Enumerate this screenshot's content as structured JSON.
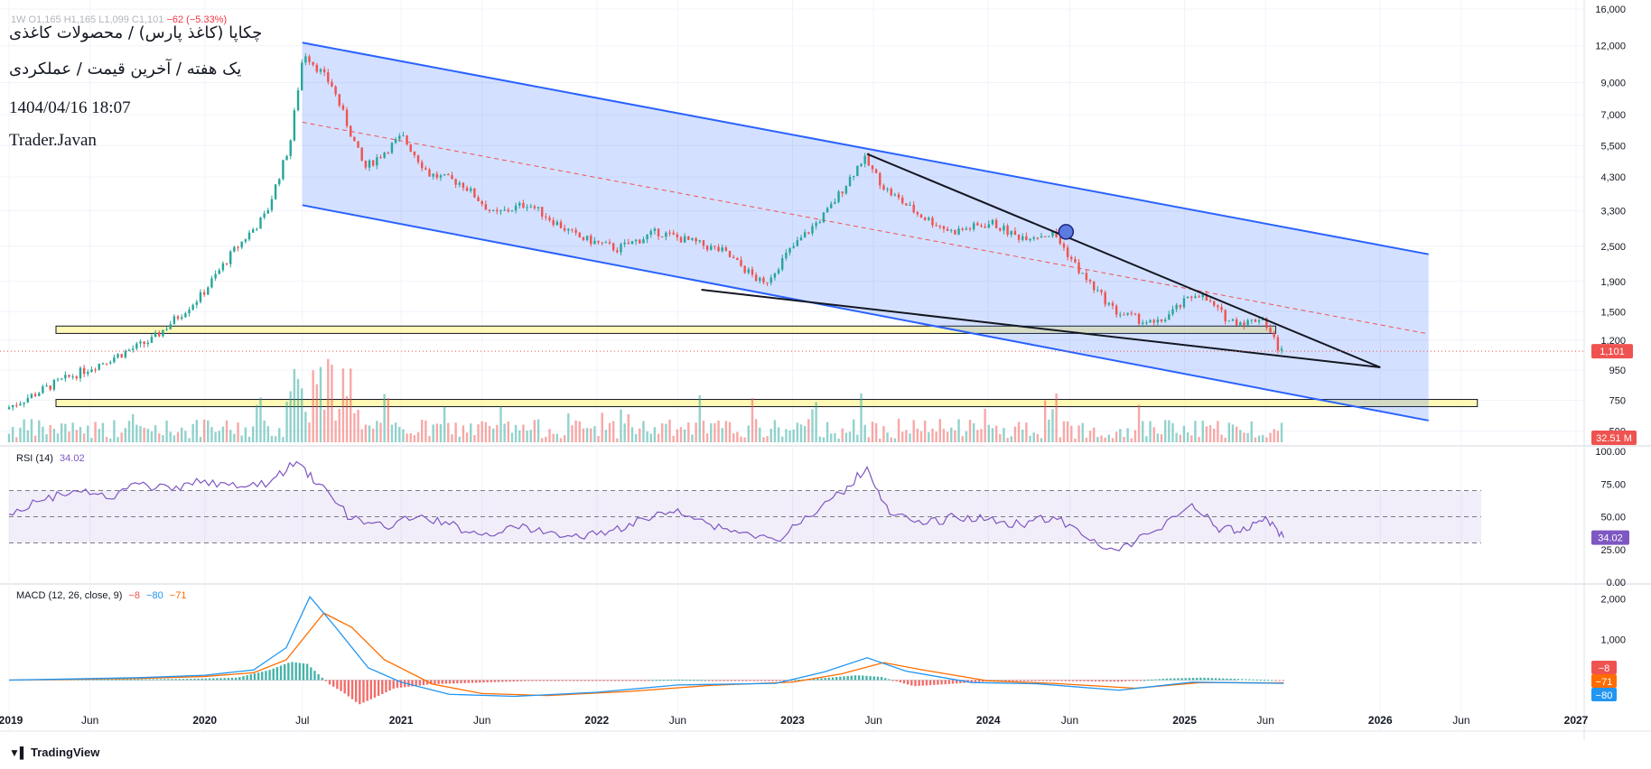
{
  "header": {
    "ohlc_prefix": "1W  O1,165  H1,165  L1,099  C1,101",
    "change": "−62 (−5.33%)",
    "title_line1": "چکاپا (کاغذ پارس) / محصولات کاغذی",
    "title_line2": "یک هفته / آخرین قیمت / عملکردی",
    "timestamp": "1404/04/16 18:07",
    "author": "Trader.Javan"
  },
  "indicators": {
    "rsi_label": "RSI (14)",
    "rsi_value": "34.02",
    "macd_label": "MACD (12, 26, close, 9)",
    "macd_hist": "−8",
    "macd_line": "−80",
    "macd_signal": "−71"
  },
  "branding": {
    "logo_text": "TradingView"
  },
  "colors": {
    "up": "#26a69a",
    "down": "#ef5350",
    "channel": "#2962ff",
    "zone": "#fff59d",
    "rsi": "#7e57c2",
    "macd": "#2196f3",
    "signal": "#ff6d00"
  },
  "chart_data": [
    {
      "type": "candlestick",
      "scale": "log",
      "ylim": [
        540,
        16000
      ],
      "y_ticks": [
        16000,
        12000,
        9000,
        7000,
        5500,
        4300,
        3300,
        2500,
        1900,
        1500,
        1200,
        950,
        750,
        590
      ],
      "y_tick_labels": [
        "16,000",
        "12,000",
        "9,000",
        "7,000",
        "5,500",
        "4,300",
        "3,300",
        "2,500",
        "1,900",
        "1,500",
        "1,200",
        "950",
        "750",
        "590"
      ],
      "last_price": 1101,
      "last_price_label": "1,101",
      "volume_label": "32.51 M",
      "x_tick_labels": [
        "2019",
        "Jun",
        "2020",
        "Jul",
        "2021",
        "Jun",
        "2022",
        "Jun",
        "2023",
        "Jun",
        "2024",
        "Jun",
        "2025",
        "Jun",
        "2026",
        "Jun",
        "2027"
      ],
      "x_tick_dates": [
        "2019-01-01",
        "2019-06-01",
        "2020-01-01",
        "2020-07-01",
        "2021-01-01",
        "2021-06-01",
        "2022-01-01",
        "2022-06-01",
        "2023-01-01",
        "2023-06-01",
        "2024-01-01",
        "2024-06-01",
        "2025-01-01",
        "2025-06-01",
        "2026-01-01",
        "2026-06-01",
        "2027-01-01"
      ],
      "price_path": [
        [
          "2019-01-01",
          700
        ],
        [
          "2019-04-01",
          850
        ],
        [
          "2019-07-01",
          1010
        ],
        [
          "2019-10-01",
          1200
        ],
        [
          "2020-01-01",
          1700
        ],
        [
          "2020-03-01",
          2400
        ],
        [
          "2020-05-01",
          3200
        ],
        [
          "2020-06-15",
          5600
        ],
        [
          "2020-07-10",
          11500
        ],
        [
          "2020-09-01",
          8800
        ],
        [
          "2020-11-01",
          4600
        ],
        [
          "2021-01-10",
          5900
        ],
        [
          "2021-03-01",
          4400
        ],
        [
          "2021-05-01",
          4100
        ],
        [
          "2021-07-01",
          3200
        ],
        [
          "2021-09-01",
          3500
        ],
        [
          "2021-12-01",
          2700
        ],
        [
          "2022-02-15",
          2450
        ],
        [
          "2022-05-01",
          2800
        ],
        [
          "2022-07-01",
          2600
        ],
        [
          "2022-09-01",
          2400
        ],
        [
          "2022-11-15",
          1850
        ],
        [
          "2023-01-01",
          2400
        ],
        [
          "2023-03-15",
          3300
        ],
        [
          "2023-05-20",
          5000
        ],
        [
          "2023-07-01",
          3900
        ],
        [
          "2023-09-01",
          3200
        ],
        [
          "2023-11-01",
          2800
        ],
        [
          "2024-01-15",
          3000
        ],
        [
          "2024-03-01",
          2700
        ],
        [
          "2024-05-10",
          2750
        ],
        [
          "2024-07-01",
          2000
        ],
        [
          "2024-09-01",
          1500
        ],
        [
          "2024-11-15",
          1350
        ],
        [
          "2025-02-01",
          1750
        ],
        [
          "2025-04-01",
          1400
        ],
        [
          "2025-05-10",
          1380
        ],
        [
          "2025-06-01",
          1450
        ],
        [
          "2025-07-05",
          1101
        ]
      ],
      "channel_upper": [
        [
          "2020-07-01",
          12300
        ],
        [
          "2026-04-01",
          2350
        ]
      ],
      "channel_lower": [
        [
          "2020-07-01",
          3450
        ],
        [
          "2026-04-01",
          640
        ]
      ],
      "channel_mid": [
        [
          "2020-07-01",
          6600
        ],
        [
          "2026-04-01",
          1260
        ]
      ],
      "wedge_upper": [
        [
          "2023-05-20",
          5150
        ],
        [
          "2026-01-01",
          970
        ]
      ],
      "wedge_lower": [
        [
          "2022-07-15",
          1780
        ],
        [
          "2026-01-01",
          970
        ]
      ],
      "support_zones": [
        {
          "date_from": "2019-01-01",
          "date_to": "2025-06-20",
          "price_low": 1265,
          "price_high": 1340
        },
        {
          "date_from": "2019-01-01",
          "date_to": "2026-07-01",
          "price_low": 715,
          "price_high": 755
        }
      ],
      "marker": {
        "date": "2024-05-25",
        "price": 2800
      }
    },
    {
      "type": "line",
      "name": "RSI (14)",
      "ylim": [
        0,
        100
      ],
      "y_ticks": [
        100,
        75,
        50,
        25,
        0
      ],
      "y_tick_labels": [
        "100.00",
        "75.00",
        "50.00",
        "25.00",
        "0.00"
      ],
      "bands": [
        30,
        50,
        70
      ],
      "current_value_label": "34.02",
      "points": [
        [
          "2019-01-01",
          52
        ],
        [
          "2019-03-01",
          62
        ],
        [
          "2019-05-01",
          70
        ],
        [
          "2019-07-01",
          64
        ],
        [
          "2019-09-01",
          75
        ],
        [
          "2019-11-01",
          70
        ],
        [
          "2020-01-01",
          78
        ],
        [
          "2020-03-01",
          72
        ],
        [
          "2020-05-01",
          76
        ],
        [
          "2020-06-20",
          92
        ],
        [
          "2020-08-01",
          75
        ],
        [
          "2020-10-01",
          48
        ],
        [
          "2020-12-01",
          42
        ],
        [
          "2021-02-01",
          50
        ],
        [
          "2021-04-01",
          44
        ],
        [
          "2021-06-01",
          36
        ],
        [
          "2021-08-01",
          42
        ],
        [
          "2021-10-01",
          38
        ],
        [
          "2021-12-01",
          34
        ],
        [
          "2022-02-01",
          40
        ],
        [
          "2022-04-01",
          48
        ],
        [
          "2022-06-01",
          56
        ],
        [
          "2022-08-01",
          44
        ],
        [
          "2022-10-01",
          38
        ],
        [
          "2022-12-01",
          32
        ],
        [
          "2023-02-01",
          50
        ],
        [
          "2023-04-01",
          68
        ],
        [
          "2023-05-20",
          88
        ],
        [
          "2023-07-01",
          52
        ],
        [
          "2023-09-01",
          44
        ],
        [
          "2023-11-01",
          50
        ],
        [
          "2024-01-01",
          48
        ],
        [
          "2024-03-01",
          44
        ],
        [
          "2024-05-01",
          50
        ],
        [
          "2024-07-01",
          34
        ],
        [
          "2024-09-01",
          24
        ],
        [
          "2024-11-01",
          38
        ],
        [
          "2025-01-15",
          60
        ],
        [
          "2025-03-01",
          42
        ],
        [
          "2025-04-15",
          38
        ],
        [
          "2025-06-01",
          50
        ],
        [
          "2025-07-05",
          34
        ]
      ]
    },
    {
      "type": "bar+line",
      "name": "MACD (12, 26, close, 9)",
      "ylim": [
        -700,
        2300
      ],
      "y_ticks": [
        2000,
        1000
      ],
      "y_tick_labels": [
        "2,000",
        "1,000"
      ],
      "value_labels": {
        "hist": "−8",
        "signal": "−71",
        "macd": "−80"
      },
      "macd_points": [
        [
          "2019-01-01",
          0
        ],
        [
          "2019-09-01",
          60
        ],
        [
          "2020-01-01",
          120
        ],
        [
          "2020-04-01",
          250
        ],
        [
          "2020-06-01",
          800
        ],
        [
          "2020-07-15",
          2050
        ],
        [
          "2020-09-01",
          1300
        ],
        [
          "2020-11-01",
          300
        ],
        [
          "2021-01-01",
          -50
        ],
        [
          "2021-04-01",
          -350
        ],
        [
          "2021-08-01",
          -400
        ],
        [
          "2022-01-01",
          -300
        ],
        [
          "2022-06-01",
          -120
        ],
        [
          "2022-12-01",
          -80
        ],
        [
          "2023-03-01",
          200
        ],
        [
          "2023-05-20",
          550
        ],
        [
          "2023-08-01",
          220
        ],
        [
          "2023-12-01",
          -60
        ],
        [
          "2024-04-01",
          -90
        ],
        [
          "2024-09-01",
          -250
        ],
        [
          "2025-01-15",
          -50
        ],
        [
          "2025-07-05",
          -80
        ]
      ],
      "signal_points": [
        [
          "2019-01-01",
          0
        ],
        [
          "2019-09-01",
          40
        ],
        [
          "2020-01-01",
          90
        ],
        [
          "2020-04-01",
          180
        ],
        [
          "2020-06-01",
          500
        ],
        [
          "2020-08-10",
          1650
        ],
        [
          "2020-10-01",
          1300
        ],
        [
          "2020-12-01",
          500
        ],
        [
          "2021-03-01",
          -100
        ],
        [
          "2021-06-01",
          -330
        ],
        [
          "2021-10-01",
          -380
        ],
        [
          "2022-03-01",
          -280
        ],
        [
          "2022-08-01",
          -130
        ],
        [
          "2023-01-01",
          -50
        ],
        [
          "2023-04-01",
          150
        ],
        [
          "2023-06-20",
          430
        ],
        [
          "2023-09-01",
          250
        ],
        [
          "2024-01-01",
          -20
        ],
        [
          "2024-05-01",
          -80
        ],
        [
          "2024-10-01",
          -200
        ],
        [
          "2025-02-01",
          -60
        ],
        [
          "2025-07-05",
          -71
        ]
      ],
      "hist_points": [
        [
          "2019-03-01",
          15
        ],
        [
          "2019-06-01",
          20
        ],
        [
          "2019-09-01",
          20
        ],
        [
          "2019-12-01",
          30
        ],
        [
          "2020-03-01",
          60
        ],
        [
          "2020-05-01",
          250
        ],
        [
          "2020-06-10",
          450
        ],
        [
          "2020-07-10",
          400
        ],
        [
          "2020-08-20",
          -100
        ],
        [
          "2020-09-15",
          -300
        ],
        [
          "2020-10-15",
          -600
        ],
        [
          "2020-11-15",
          -420
        ],
        [
          "2020-12-20",
          -200
        ],
        [
          "2021-03-01",
          -100
        ],
        [
          "2021-06-01",
          -60
        ],
        [
          "2021-09-01",
          -20
        ],
        [
          "2022-01-01",
          -20
        ],
        [
          "2022-06-01",
          10
        ],
        [
          "2022-12-01",
          -25
        ],
        [
          "2023-03-01",
          50
        ],
        [
          "2023-05-01",
          120
        ],
        [
          "2023-06-15",
          80
        ],
        [
          "2023-08-15",
          -150
        ],
        [
          "2023-10-15",
          -100
        ],
        [
          "2024-01-01",
          -30
        ],
        [
          "2024-05-01",
          -20
        ],
        [
          "2024-09-01",
          -40
        ],
        [
          "2024-12-01",
          40
        ],
        [
          "2025-02-01",
          60
        ],
        [
          "2025-05-01",
          20
        ],
        [
          "2025-07-05",
          -8
        ]
      ]
    }
  ]
}
